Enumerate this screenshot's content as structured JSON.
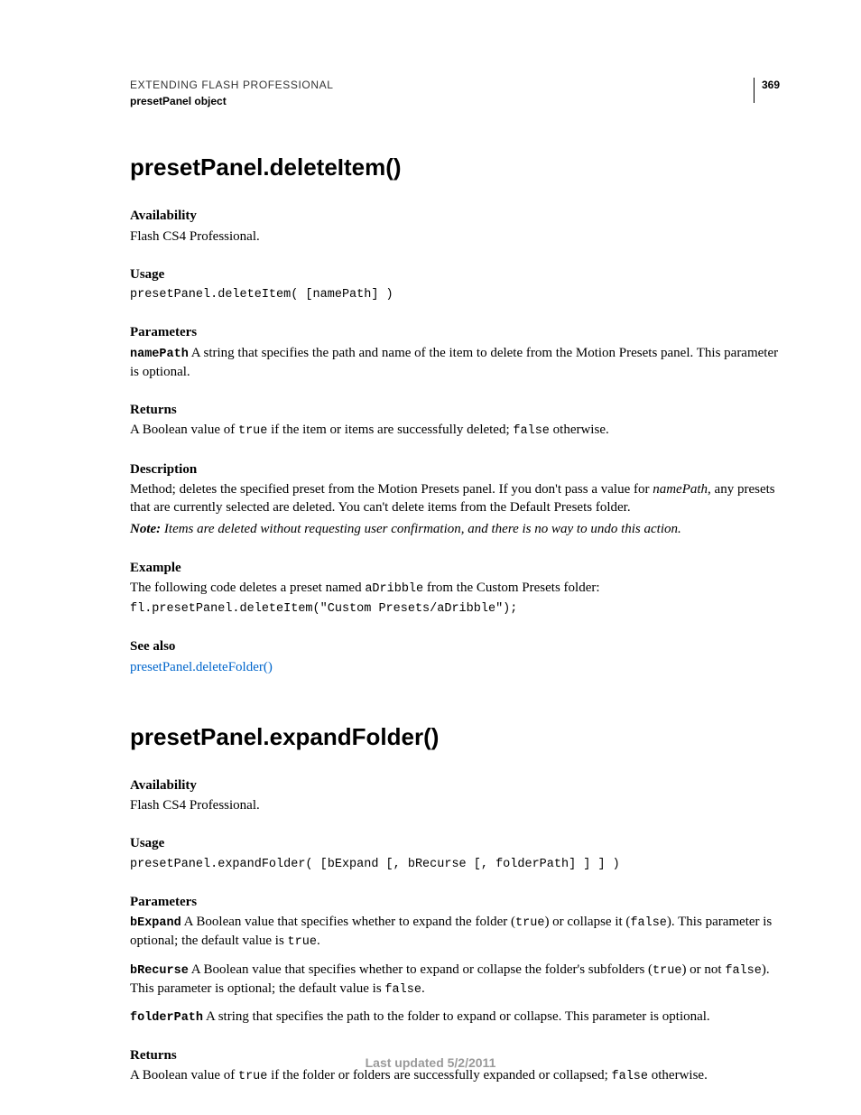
{
  "header": {
    "doc_title": "EXTENDING FLASH PROFESSIONAL",
    "section": "presetPanel object",
    "page_number": "369"
  },
  "entry1": {
    "title": "presetPanel.deleteItem()",
    "availability_h": "Availability",
    "availability_t": "Flash CS4 Professional.",
    "usage_h": "Usage",
    "usage_code": "presetPanel.deleteItem( [namePath] )",
    "parameters_h": "Parameters",
    "param_name": "namePath",
    "param_text": "  A string that specifies the path and name of the item to delete from the Motion Presets panel. This parameter is optional.",
    "returns_h": "Returns",
    "returns_pre": "A Boolean value of ",
    "returns_code1": "true",
    "returns_mid": " if the item or items are successfully deleted; ",
    "returns_code2": "false",
    "returns_post": " otherwise.",
    "description_h": "Description",
    "desc_pre": "Method; deletes the specified preset from the Motion Presets panel. If you don't pass a value for ",
    "desc_em": "namePath",
    "desc_post": ", any presets that are currently selected are deleted. You can't delete items from the Default Presets folder.",
    "note_label": "Note:",
    "note_body": " Items are deleted without requesting user confirmation, and there is no way to undo this action.",
    "example_h": "Example",
    "example_pre": "The following code deletes a preset named ",
    "example_code_inline": "aDribble",
    "example_post": " from the Custom Presets folder:",
    "example_code": "fl.presetPanel.deleteItem(\"Custom Presets/aDribble\");",
    "seealso_h": "See also",
    "seealso_link": "presetPanel.deleteFolder()"
  },
  "entry2": {
    "title": "presetPanel.expandFolder()",
    "availability_h": "Availability",
    "availability_t": "Flash CS4 Professional.",
    "usage_h": "Usage",
    "usage_code": "presetPanel.expandFolder( [bExpand [, bRecurse [, folderPath] ] ] )",
    "parameters_h": "Parameters",
    "p1_name": "bExpand",
    "p1_a": "  A Boolean value that specifies whether to expand the folder (",
    "p1_true": "true",
    "p1_b": ") or collapse it (",
    "p1_false": "false",
    "p1_c": "). This parameter is optional; the default value is ",
    "p1_def": "true",
    "p1_d": ".",
    "p2_name": "bRecurse",
    "p2_a": "  A Boolean value that specifies whether to expand or collapse the folder's subfolders (",
    "p2_true": "true",
    "p2_b": ") or not ",
    "p2_false": "false",
    "p2_c": "). This parameter is optional; the default value is ",
    "p2_def": "false",
    "p2_d": ".",
    "p3_name": "folderPath",
    "p3_text": "  A string that specifies the path to the folder to expand or collapse. This parameter is optional.",
    "returns_h": "Returns",
    "returns_pre": "A Boolean value of ",
    "returns_code1": "true",
    "returns_mid": " if the folder or folders are successfully expanded or collapsed; ",
    "returns_code2": "false",
    "returns_post": " otherwise."
  },
  "footer": {
    "text": "Last updated 5/2/2011"
  }
}
